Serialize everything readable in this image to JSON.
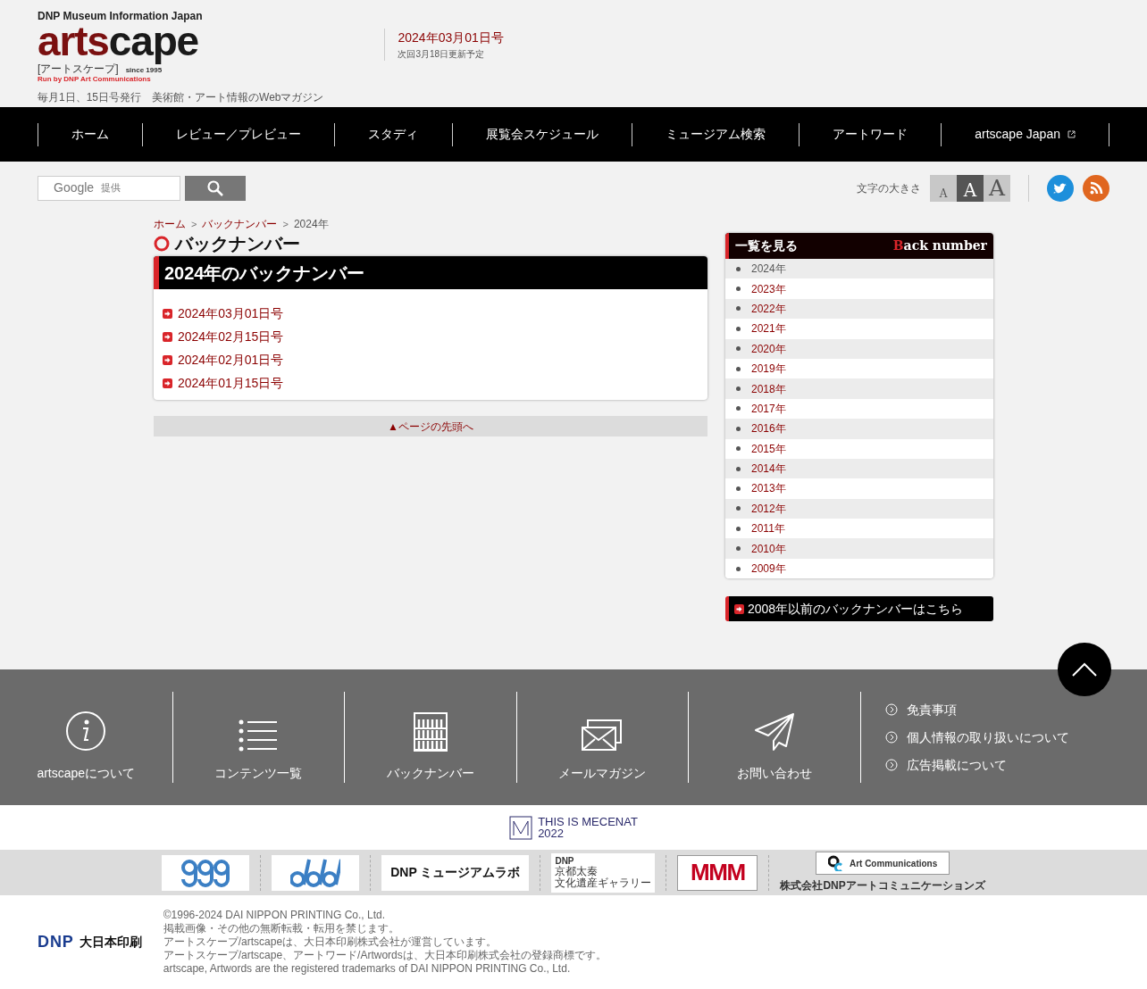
{
  "header": {
    "logo_top": "DNP Museum Information Japan",
    "logo": "artscape",
    "logo_kana": "[アートスケープ]",
    "logo_since": "since 1995",
    "logo_run_by": "Run by DNP Art Communications",
    "tagline": "毎月1日、15日号発行　美術館・アート情報のWebマガジン",
    "issue": "2024年03月01日号",
    "next_update": "次回3月18日更新予定"
  },
  "nav": [
    {
      "label": "ホーム",
      "external": false
    },
    {
      "label": "レビュー／プレビュー",
      "external": false
    },
    {
      "label": "スタディ",
      "external": false
    },
    {
      "label": "展覧会スケジュール",
      "external": false
    },
    {
      "label": "ミュージアム検索",
      "external": false
    },
    {
      "label": "アートワード",
      "external": false
    },
    {
      "label": "artscape Japan",
      "external": true
    }
  ],
  "search": {
    "provider": "Google",
    "provider_note": "提供"
  },
  "font_size": {
    "label": "文字の大きさ",
    "options": [
      {
        "label": "A",
        "selected": false
      },
      {
        "label": "A",
        "selected": true
      },
      {
        "label": "A",
        "selected": false
      }
    ]
  },
  "breadcrumb": [
    {
      "label": "ホーム",
      "link": true
    },
    {
      "separator": ">",
      "label": "バックナンバー",
      "link": true
    },
    {
      "separator": ">",
      "label": "2024年",
      "link": false
    }
  ],
  "page_title": "バックナンバー",
  "panel": {
    "title": "2024年のバックナンバー",
    "items": [
      "2024年03月01日号",
      "2024年02月15日号",
      "2024年02月01日号",
      "2024年01月15日号"
    ]
  },
  "page_top": "▲ページの先頭へ",
  "sidebar": {
    "title": "一覧を見る",
    "title_en": "Back number",
    "years": [
      {
        "label": "2024年",
        "selected": true
      },
      {
        "label": "2023年",
        "selected": false
      },
      {
        "label": "2022年",
        "selected": false
      },
      {
        "label": "2021年",
        "selected": false
      },
      {
        "label": "2020年",
        "selected": false
      },
      {
        "label": "2019年",
        "selected": false
      },
      {
        "label": "2018年",
        "selected": false
      },
      {
        "label": "2017年",
        "selected": false
      },
      {
        "label": "2016年",
        "selected": false
      },
      {
        "label": "2015年",
        "selected": false
      },
      {
        "label": "2014年",
        "selected": false
      },
      {
        "label": "2013年",
        "selected": false
      },
      {
        "label": "2012年",
        "selected": false
      },
      {
        "label": "2011年",
        "selected": false
      },
      {
        "label": "2010年",
        "selected": false
      },
      {
        "label": "2009年",
        "selected": false
      }
    ],
    "older_link": "2008年以前のバックナンバーはこちら"
  },
  "footer": {
    "nav": [
      {
        "kind": "info",
        "label": "artscapeについて"
      },
      {
        "kind": "list",
        "label": "コンテンツ一覧"
      },
      {
        "kind": "archive",
        "label": "バックナンバー"
      },
      {
        "kind": "mail",
        "label": "メールマガジン"
      },
      {
        "kind": "send",
        "label": "お問い合わせ"
      }
    ],
    "links": [
      "免責事項",
      "個人情報の取り扱いについて",
      "広告掲載について"
    ],
    "mecenat": [
      "THIS IS MECENAT",
      "2022"
    ],
    "partners": [
      {
        "kind": "ggg"
      },
      {
        "kind": "ddd"
      },
      {
        "kind": "text",
        "text": "DNP ミュージアムラボ"
      },
      {
        "kind": "kyoto",
        "lines": [
          "DNP",
          "京都太秦",
          "文化遺産ギャラリー"
        ]
      },
      {
        "kind": "mmm",
        "text": "MMM"
      },
      {
        "kind": "ac",
        "text": "Art Communications",
        "caption": "株式会社DNPアートコミュニケーションズ"
      }
    ],
    "company": "大日本印刷",
    "company_mark": "DNP",
    "copyright": [
      "©1996-2024 DAI NIPPON PRINTING Co., Ltd.",
      "掲載画像・その他の無断転載・転用を禁じます。",
      "アートスケープ/artscapeは、大日本印刷株式会社が運営しています。",
      "アートスケープ/artscape、アートワード/Artwordsは、大日本印刷株式会社の登録商標です。",
      "artscape, Artwords are the registered trademarks of DAI NIPPON PRINTING Co., Ltd."
    ]
  }
}
